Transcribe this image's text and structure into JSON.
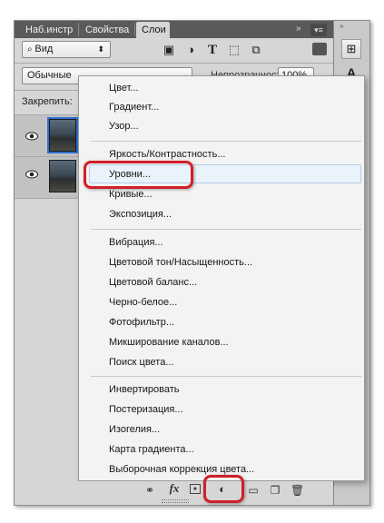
{
  "tabs": [
    {
      "label": "Наб.инстр",
      "active": false
    },
    {
      "label": "Свойства",
      "active": false
    },
    {
      "label": "Слои",
      "active": true
    }
  ],
  "filter": {
    "value": "Вид"
  },
  "blend_mode": {
    "value": "Обычные"
  },
  "opacity": {
    "label": "Непрозрачность:",
    "value": "100%"
  },
  "lock": {
    "label": "Закрепить:"
  },
  "menu": {
    "group1": [
      "Цвет...",
      "Градиент...",
      "Узор..."
    ],
    "group2": [
      "Яркость/Контрастность...",
      "Уровни...",
      "Кривые...",
      "Экспозиция..."
    ],
    "group3": [
      "Вибрация...",
      "Цветовой тон/Насыщенность...",
      "Цветовой баланс...",
      "Черно-белое...",
      "Фотофильтр...",
      "Микширование каналов...",
      "Поиск цвета..."
    ],
    "group4": [
      "Инвертировать",
      "Постеризация...",
      "Изогелия...",
      "Карта градиента...",
      "Выборочная коррекция цвета..."
    ]
  },
  "highlight": {
    "color": "#d11f26"
  },
  "icons": [
    "visibility-eye-icon",
    "image-filter-icon",
    "adjustment-filter-icon",
    "text-filter-icon",
    "shape-filter-icon",
    "smart-object-filter-icon",
    "link-icon",
    "fx-icon",
    "mask-icon",
    "adjustment-layer-icon",
    "group-icon",
    "new-layer-icon",
    "trash-icon",
    "brush-icon",
    "paragraph-icon"
  ]
}
